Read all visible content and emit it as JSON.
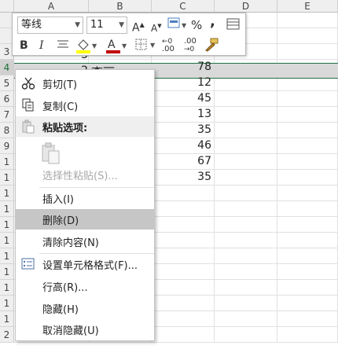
{
  "sheet": {
    "columns": [
      "A",
      "B",
      "C",
      "D",
      "E"
    ],
    "row_numbers": [
      "",
      "",
      "3",
      "4",
      "5",
      "6",
      "7",
      "8",
      "9",
      "1",
      "1",
      "1",
      "1",
      "1",
      "1",
      "1",
      "1",
      "1",
      "1",
      "1",
      "2"
    ],
    "cells": {
      "row3_b": "3",
      "row4_b": "2",
      "row4_b_name": "李丽",
      "c_values": [
        "78",
        "12",
        "45",
        "13",
        "35",
        "46",
        "67",
        "35"
      ]
    }
  },
  "mini_toolbar": {
    "font_name": "等线",
    "font_size": "11",
    "percent": "%",
    "comma": ",",
    "bold": "B",
    "italic": "I",
    "decimal_increase": ".00",
    "decimal_decrease": ".00"
  },
  "context_menu": {
    "items": [
      {
        "label": "剪切(T)",
        "icon": "scissors-icon",
        "enabled": true
      },
      {
        "label": "复制(C)",
        "icon": "copy-icon",
        "enabled": true
      },
      {
        "label": "粘贴选项:",
        "icon": "paste-icon",
        "enabled": false,
        "header": true
      },
      {
        "label": "选择性粘贴(S)...",
        "icon": "",
        "enabled": false
      },
      {
        "label": "插入(I)",
        "icon": "",
        "enabled": true
      },
      {
        "label": "删除(D)",
        "icon": "",
        "enabled": true,
        "highlighted": true
      },
      {
        "label": "清除内容(N)",
        "icon": "",
        "enabled": true
      },
      {
        "label": "设置单元格格式(F)...",
        "icon": "format-cells-icon",
        "enabled": true
      },
      {
        "label": "行高(R)...",
        "icon": "",
        "enabled": true
      },
      {
        "label": "隐藏(H)",
        "icon": "",
        "enabled": true
      },
      {
        "label": "取消隐藏(U)",
        "icon": "",
        "enabled": true
      }
    ]
  },
  "colors": {
    "accent": "#217346",
    "font_color_bar": "#c00000",
    "fill_color_bar": "#ffff00",
    "highlight": "#c6c6c6"
  }
}
